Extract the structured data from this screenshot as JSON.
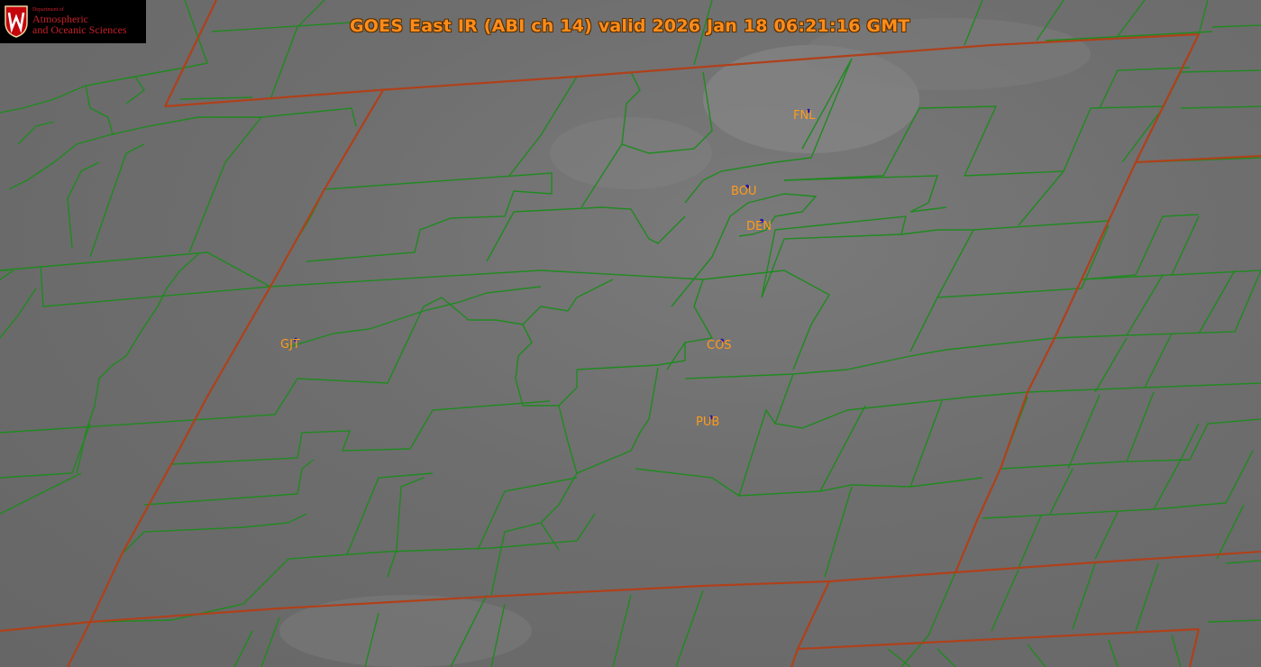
{
  "title": "GOES East IR (ABI ch 14) valid 2026 Jan 18 06:21:16 GMT",
  "logo": {
    "dept": "Department of",
    "line1": "Atmospheric",
    "line2": "and Oceanic Sciences",
    "crest_icon": "uw-crest-icon"
  },
  "colors": {
    "county_border": "#1f8a1f",
    "state_border": "#b0401a",
    "label": "#ff9a1a",
    "site_marker": "#1a1ab0"
  },
  "stations": [
    {
      "id": "FNL",
      "label": "FNL"
    },
    {
      "id": "BOU",
      "label": "BOU"
    },
    {
      "id": "DEN",
      "label": "DEN"
    },
    {
      "id": "GJT",
      "label": "GJT"
    },
    {
      "id": "COS",
      "label": "COS"
    },
    {
      "id": "PUB",
      "label": "PUB"
    }
  ]
}
